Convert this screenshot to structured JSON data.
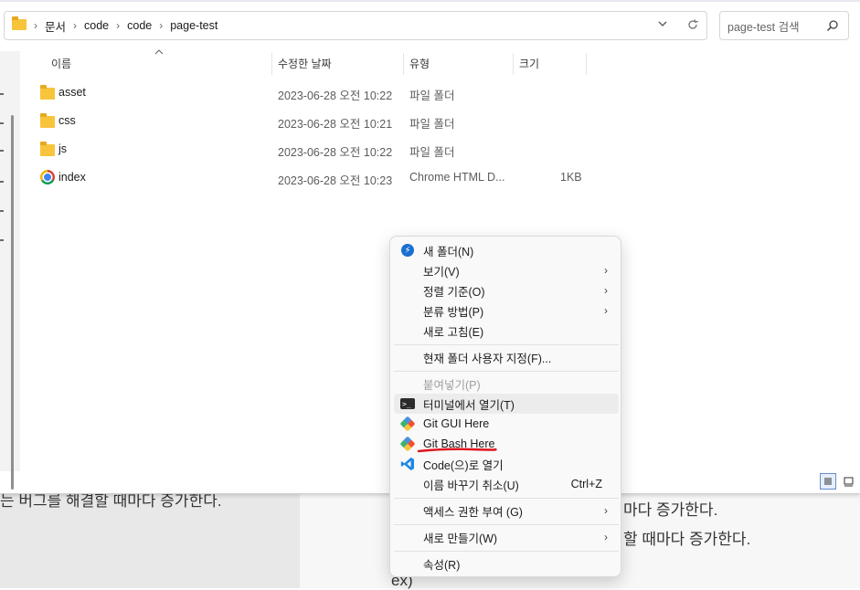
{
  "background": {
    "left_text": "는 버그를 해결할 때마다 증가한다.",
    "right_line1": "마다 증가한다.",
    "right_line2": "할 때마다 증가한다.",
    "right_line3": "ex)"
  },
  "address_bar": {
    "crumbs": [
      "문서",
      "code",
      "code",
      "page-test"
    ],
    "dropdown_icon": "chevron-down-icon",
    "refresh_icon": "refresh-icon"
  },
  "search": {
    "placeholder": "page-test 검색",
    "icon": "search-icon"
  },
  "columns": {
    "name": "이름",
    "date": "수정한 날짜",
    "type": "유형",
    "size": "크기"
  },
  "files": [
    {
      "name": "asset",
      "date": "2023-06-28 오전 10:22",
      "type": "파일 폴더",
      "size": ""
    },
    {
      "name": "css",
      "date": "2023-06-28 오전 10:21",
      "type": "파일 폴더",
      "size": ""
    },
    {
      "name": "js",
      "date": "2023-06-28 오전 10:22",
      "type": "파일 폴더",
      "size": ""
    },
    {
      "name": "index",
      "date": "2023-06-28 오전 10:23",
      "type": "Chrome HTML D...",
      "size": "1KB"
    }
  ],
  "context_menu": {
    "new_folder": "새 폴더(N)",
    "view": "보기(V)",
    "sort": "정렬 기준(O)",
    "group": "분류 방법(P)",
    "refresh": "새로 고침(E)",
    "customize": "현재 폴더 사용자 지정(F)...",
    "paste": "붙여넣기(P)",
    "terminal": "터미널에서 열기(T)",
    "git_gui": "Git GUI Here",
    "git_bash": "Git Bash Here",
    "vscode": "Code(으)로 열기",
    "undo_rename": "이름 바꾸기 취소(U)",
    "undo_shortcut": "Ctrl+Z",
    "access": "액세스 권한 부여 (G)",
    "new": "새로 만들기(W)",
    "properties": "속성(R)"
  },
  "colors": {
    "accent": "#1a6fd1",
    "underline": "#e0141e",
    "folder": "#f7c43c"
  }
}
